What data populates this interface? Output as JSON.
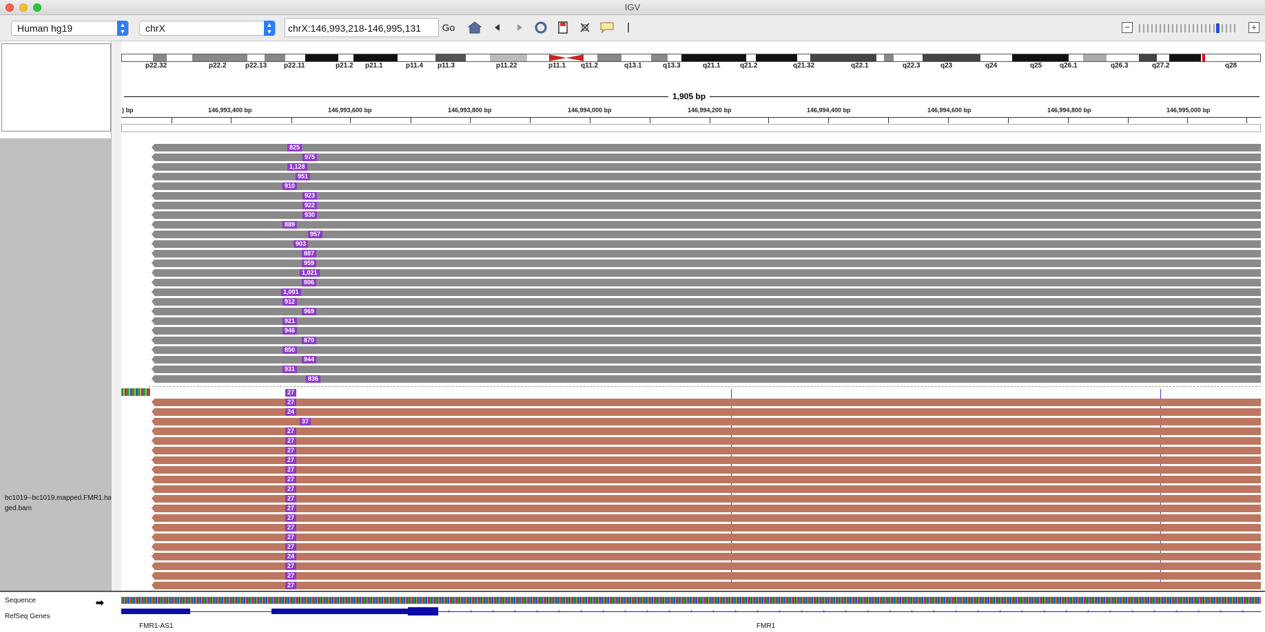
{
  "window": {
    "title": "IGV"
  },
  "toolbar": {
    "genome": "Human hg19",
    "chromosome": "chrX",
    "locus": "chrX:146,993,218-146,995,131",
    "go_label": "Go"
  },
  "ideogram": {
    "bands": [
      "p22.32",
      "p22.2",
      "p22.13",
      "p22.11",
      "p21.2",
      "p21.1",
      "p11.4",
      "p11.3",
      "p11.22",
      "p11.1",
      "q11.2",
      "q13.1",
      "q13.3",
      "q21.1",
      "q21.2",
      "q21.32",
      "q22.1",
      "q22.3",
      "q23",
      "q24",
      "q25",
      "q26.1",
      "q26.3",
      "q27.2",
      "q28"
    ]
  },
  "ruler": {
    "span": "1,905 bp",
    "ticks": [
      ") bp",
      "146,993,400 bp",
      "146,993,600 bp",
      "146,993,800 bp",
      "146,994,000 bp",
      "146,994,200 bp",
      "146,994,400 bp",
      "146,994,600 bp",
      "146,994,800 bp",
      "146,995,000 bp"
    ]
  },
  "track": {
    "name": "bc1019--bc1019.mapped.FMR1.haged.bam",
    "group1_insertions": [
      "825",
      "975",
      "1,128",
      "951",
      "910",
      "923",
      "922",
      "930",
      "889",
      "957",
      "903",
      "887",
      "959",
      "1,021",
      "906",
      "1,001",
      "912",
      "969",
      "921",
      "946",
      "870",
      "850",
      "944",
      "931",
      "836"
    ],
    "group2_insertions": [
      "27",
      "27",
      "24",
      "37",
      "27",
      "27",
      "27",
      "27",
      "27",
      "27",
      "27",
      "27",
      "27",
      "27",
      "27",
      "27",
      "27",
      "24",
      "27",
      "27",
      "27"
    ],
    "colors": {
      "group1_read": "#8a8a8a",
      "group2_read": "#bd7760",
      "insertion": "#8e3acb"
    }
  },
  "bottom": {
    "sequence_label": "Sequence",
    "genes_label": "RefSeq Genes",
    "genes": [
      "FMR1-AS1",
      "FMR1"
    ]
  }
}
